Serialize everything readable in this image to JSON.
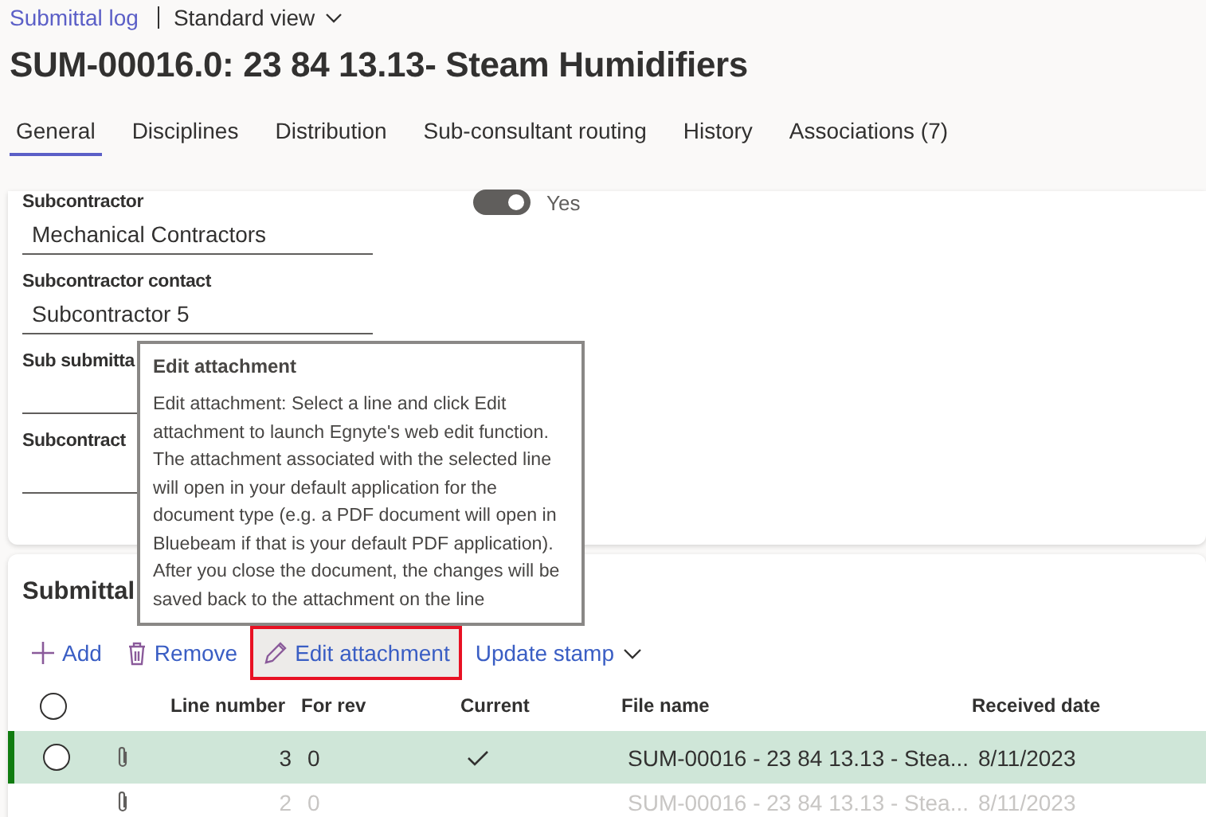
{
  "breadcrumb": {
    "link": "Submittal log",
    "view": "Standard view"
  },
  "title": "SUM-00016.0: 23 84 13.13- Steam Humidifiers",
  "tabs": [
    {
      "label": "General",
      "selected": true
    },
    {
      "label": "Disciplines",
      "selected": false
    },
    {
      "label": "Distribution",
      "selected": false
    },
    {
      "label": "Sub-consultant routing",
      "selected": false
    },
    {
      "label": "History",
      "selected": false
    },
    {
      "label": "Associations (7)",
      "selected": false
    }
  ],
  "fields": [
    {
      "label": "Subcontractor",
      "value": "Mechanical Contractors"
    },
    {
      "label": "Subcontractor contact",
      "value": "Subcontractor 5"
    },
    {
      "label": "Sub submitta"
    },
    {
      "label": "Subcontract"
    }
  ],
  "toggle": {
    "on": true,
    "label": "Yes"
  },
  "tooltip": {
    "title": "Edit attachment",
    "text": "Edit attachment: Select a line and click Edit attachment to launch Egnyte's web edit function. The attachment associated with the selected line will open in your default application for the document type (e.g. a PDF document will open in Bluebeam if that is your default PDF application). After you close the document, the changes will be saved back to the attachment on the line"
  },
  "section_title": "Submittal",
  "toolbar": [
    {
      "kind": "add",
      "label": "Add",
      "highlighted": false
    },
    {
      "kind": "remove",
      "label": "Remove",
      "highlighted": false
    },
    {
      "kind": "edit",
      "label": "Edit attachment",
      "highlighted": true
    },
    {
      "kind": "menu",
      "label": "Update stamp",
      "highlighted": false
    }
  ],
  "table": {
    "all_selected": false,
    "columns": [
      "Line number",
      "For rev",
      "Current",
      "File name",
      "Received date"
    ],
    "rows": [
      {
        "selected": true,
        "faded": false,
        "line": "3",
        "rev": "0",
        "current": true,
        "file": "SUM-00016 - 23 84 13.13 - Stea...",
        "date": "8/11/2023"
      },
      {
        "selected": false,
        "faded": true,
        "line": "2",
        "rev": "0",
        "current": false,
        "file": "SUM-00016 - 23 84 13.13 - Stea...",
        "date": "8/11/2023"
      }
    ]
  }
}
